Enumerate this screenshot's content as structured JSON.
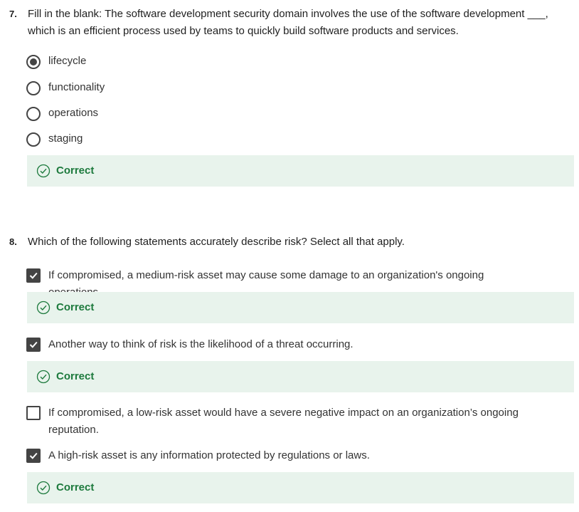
{
  "q7": {
    "number": "7.",
    "text": "Fill in the blank: The software development security domain involves the use of the software development ___, which is an efficient process used by teams to quickly build software products and services.",
    "options": [
      {
        "label": "lifecycle",
        "checked": true
      },
      {
        "label": "functionality",
        "checked": false
      },
      {
        "label": "operations",
        "checked": false
      },
      {
        "label": "staging",
        "checked": false
      }
    ],
    "feedback": "Correct"
  },
  "q8": {
    "number": "8.",
    "text": "Which of the following statements accurately describe risk? Select all that apply.",
    "options": [
      {
        "label": "If compromised, a medium-risk asset may cause some damage to an organization's ongoing operations.",
        "checked": true,
        "feedback": "Correct"
      },
      {
        "label": "Another way to think of risk is the likelihood of a threat occurring.",
        "checked": true,
        "feedback": "Correct"
      },
      {
        "label": "If compromised, a low-risk asset would have a severe negative impact on an organization’s ongoing reputation.",
        "checked": false
      },
      {
        "label": "A high-risk asset is any information protected by regulations or laws.",
        "checked": true,
        "feedback": "Correct"
      }
    ]
  },
  "colors": {
    "feedback_bg": "#e8f3ec",
    "feedback_text": "#1d7a3d",
    "control": "#444444"
  },
  "icons": {
    "radio_checked": "radio-checked-icon",
    "checkbox_checked": "checkbox-checked-icon",
    "correct": "check-circle-icon"
  }
}
